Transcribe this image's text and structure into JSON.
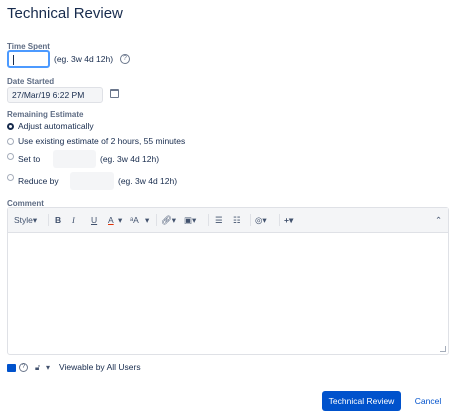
{
  "dialog": {
    "title": "Technical Review"
  },
  "time_spent": {
    "label": "Time Spent",
    "value": "",
    "hint": "(eg. 3w 4d 12h)"
  },
  "date_started": {
    "label": "Date Started",
    "value": "27/Mar/19 6:22 PM"
  },
  "remaining_estimate": {
    "label": "Remaining Estimate",
    "options": [
      {
        "label": "Adjust automatically",
        "selected": true
      },
      {
        "label": "Use existing estimate of 2 hours, 55 minutes",
        "selected": false
      },
      {
        "label": "Set to",
        "hint": "(eg. 3w 4d 12h)",
        "selected": false
      },
      {
        "label": "Reduce by",
        "hint": "(eg. 3w 4d 12h)",
        "selected": false
      }
    ]
  },
  "comment": {
    "label": "Comment",
    "value": "",
    "toolbar": {
      "style": "Style",
      "bold": "B",
      "italic": "I",
      "underline": "U",
      "text_color": "A",
      "more_formatting": "ᵃA"
    }
  },
  "footer": {
    "visibility": "Viewable by All Users"
  },
  "actions": {
    "submit": "Technical Review",
    "cancel": "Cancel"
  }
}
